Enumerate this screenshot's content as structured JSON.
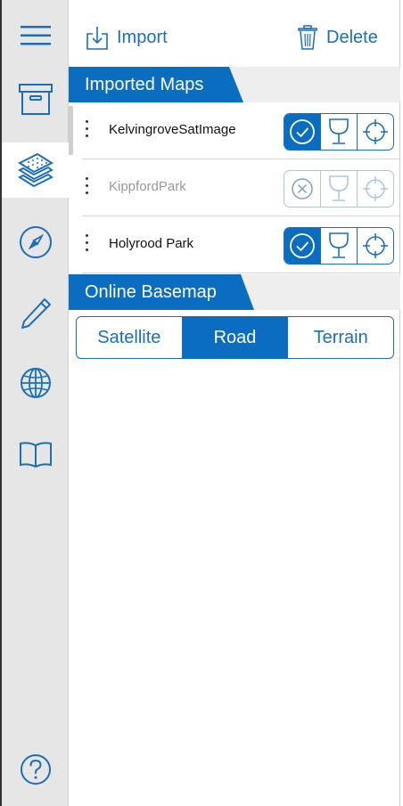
{
  "toolbar": {
    "import_label": "Import",
    "delete_label": "Delete"
  },
  "sections": {
    "imported_maps": "Imported Maps",
    "online_basemap": "Online Basemap"
  },
  "maps": [
    {
      "name": "KelvingroveSatImage",
      "visible": true,
      "enabled": true
    },
    {
      "name": "KippfordPark",
      "visible": false,
      "enabled": false
    },
    {
      "name": "Holyrood Park",
      "visible": true,
      "enabled": true
    }
  ],
  "basemap": {
    "options": [
      "Satellite",
      "Road",
      "Terrain"
    ],
    "selected": "Road"
  },
  "sidebar": {
    "items": [
      "menu-icon",
      "archive-icon",
      "layers-icon",
      "compass-icon",
      "pencil-icon",
      "globe-icon",
      "book-icon",
      "help-icon"
    ],
    "active": "layers-icon"
  },
  "colors": {
    "accent": "#0b6dbf",
    "sidebar_bg": "#e6e6e6",
    "muted_text": "#999999"
  }
}
